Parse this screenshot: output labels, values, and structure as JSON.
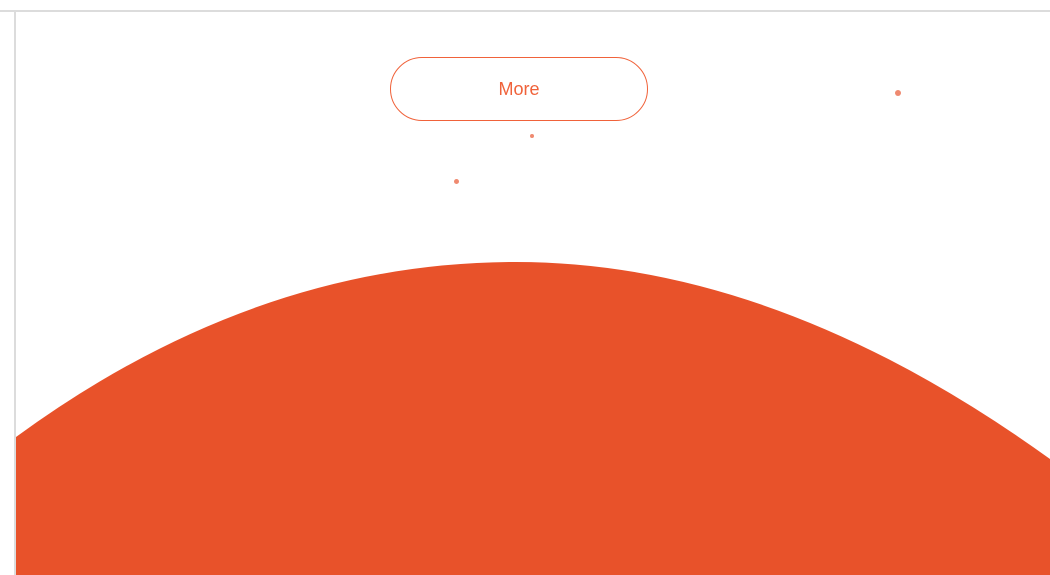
{
  "cta": {
    "more_label": "More"
  },
  "colors": {
    "accent": "#e8522a",
    "accent_outline": "#f0623a",
    "dot": "#ef8a70",
    "frame_border": "#dcdcdc",
    "background": "#ffffff"
  },
  "decorations": {
    "planet": "orange-planet-arc",
    "dots": [
      "star-dot",
      "star-dot",
      "star-dot"
    ]
  }
}
